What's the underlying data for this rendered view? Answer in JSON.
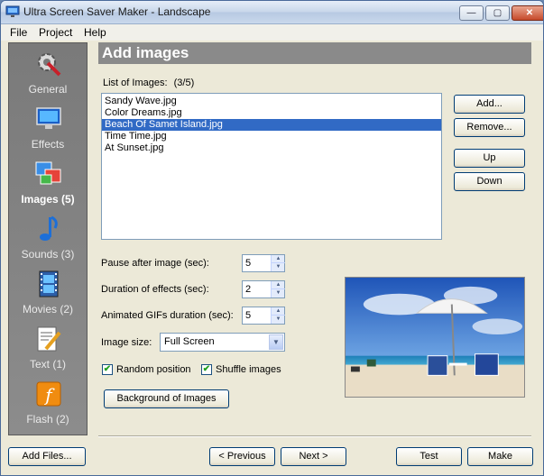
{
  "window": {
    "title": "Ultra Screen Saver Maker - Landscape"
  },
  "titlebar_buttons": {
    "minimize": "—",
    "maximize": "▢",
    "close": "✕"
  },
  "menu": [
    "File",
    "Project",
    "Help"
  ],
  "sidebar": {
    "items": [
      {
        "label": "General",
        "icon": "gear-icon"
      },
      {
        "label": "Effects",
        "icon": "monitor-icon"
      },
      {
        "label": "Images (5)",
        "icon": "images-icon",
        "active": true
      },
      {
        "label": "Sounds (3)",
        "icon": "music-note-icon"
      },
      {
        "label": "Movies (2)",
        "icon": "film-icon"
      },
      {
        "label": "Text (1)",
        "icon": "text-pencil-icon"
      },
      {
        "label": "Flash (2)",
        "icon": "flash-icon"
      }
    ]
  },
  "section": {
    "title": "Add images"
  },
  "list": {
    "label": "List of Images:",
    "count": "(3/5)",
    "items": [
      "Sandy Wave.jpg",
      "Color Dreams.jpg",
      "Beach Of Samet Island.jpg",
      "Time Time.jpg",
      "At Sunset.jpg"
    ],
    "selected_index": 2
  },
  "list_buttons": {
    "add": "Add...",
    "remove": "Remove...",
    "up": "Up",
    "down": "Down"
  },
  "settings": {
    "pause_label": "Pause after image (sec):",
    "pause_value": "5",
    "duration_label": "Duration of effects (sec):",
    "duration_value": "2",
    "gif_label": "Animated GIFs duration (sec):",
    "gif_value": "5",
    "size_label": "Image size:",
    "size_value": "Full Screen",
    "random_label": "Random position",
    "random_checked": true,
    "shuffle_label": "Shuffle images",
    "shuffle_checked": true,
    "background_button": "Background of Images"
  },
  "footer": {
    "add_files": "Add Files...",
    "previous": "< Previous",
    "next": "Next >",
    "test": "Test",
    "make": "Make"
  },
  "colors": {
    "selection": "#316ac5",
    "sidebar": "#838383",
    "header": "#8a8a8a"
  }
}
